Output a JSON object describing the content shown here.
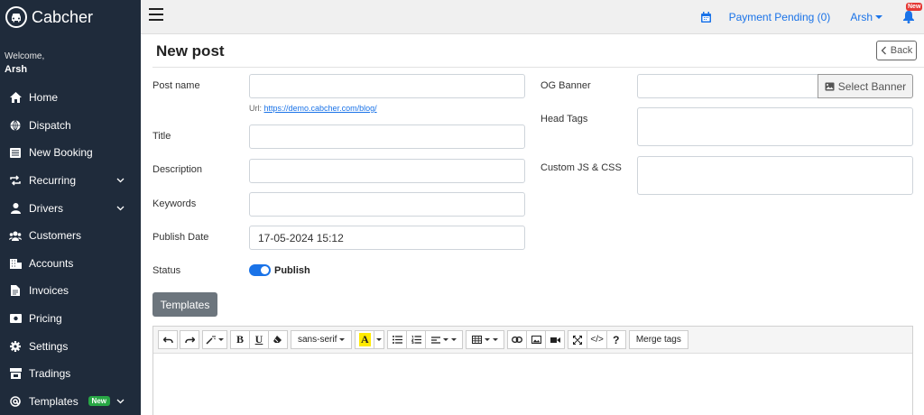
{
  "brand": {
    "name": "Cabcher"
  },
  "welcome": {
    "greeting": "Welcome,",
    "user": "Arsh"
  },
  "sidebar": {
    "items": [
      {
        "label": "Home",
        "icon": "home-icon",
        "chevron": false
      },
      {
        "label": "Dispatch",
        "icon": "globe-icon",
        "chevron": false
      },
      {
        "label": "New Booking",
        "icon": "list-icon",
        "chevron": false
      },
      {
        "label": "Recurring",
        "icon": "repeat-icon",
        "chevron": true
      },
      {
        "label": "Drivers",
        "icon": "user-icon",
        "chevron": true
      },
      {
        "label": "Customers",
        "icon": "users-icon",
        "chevron": false
      },
      {
        "label": "Accounts",
        "icon": "building-icon",
        "chevron": false
      },
      {
        "label": "Invoices",
        "icon": "file-icon",
        "chevron": false
      },
      {
        "label": "Pricing",
        "icon": "money-icon",
        "chevron": false
      },
      {
        "label": "Settings",
        "icon": "gear-icon",
        "chevron": false
      },
      {
        "label": "Tradings",
        "icon": "store-icon",
        "chevron": false
      },
      {
        "label": "Templates",
        "icon": "at-icon",
        "chevron": true,
        "badge": "New"
      }
    ]
  },
  "topbar": {
    "payment_pending": "Payment Pending (0)",
    "user": "Arsh",
    "bell_badge": "New"
  },
  "page": {
    "title": "New post",
    "back_label": "Back"
  },
  "form": {
    "post_name_label": "Post name",
    "url_prefix": "Url:",
    "url_link": "https://demo.cabcher.com/blog/",
    "title_label": "Title",
    "description_label": "Description",
    "keywords_label": "Keywords",
    "publish_date_label": "Publish Date",
    "publish_date_value": "17-05-2024 15:12",
    "status_label": "Status",
    "status_value": "Publish",
    "og_banner_label": "OG Banner",
    "select_banner_label": "Select Banner",
    "head_tags_label": "Head Tags",
    "custom_js_label": "Custom JS & CSS",
    "templates_button": "Templates"
  },
  "editor": {
    "font_family": "sans-serif",
    "merge_tags": "Merge tags",
    "help": "?",
    "code_label": "</>",
    "bold": "B",
    "underline": "U",
    "color_letter": "A"
  },
  "colors": {
    "accent": "#1a73e8",
    "sidebar_bg": "#1f2b3b",
    "badge_green": "#28a745",
    "badge_red": "#e53935"
  }
}
